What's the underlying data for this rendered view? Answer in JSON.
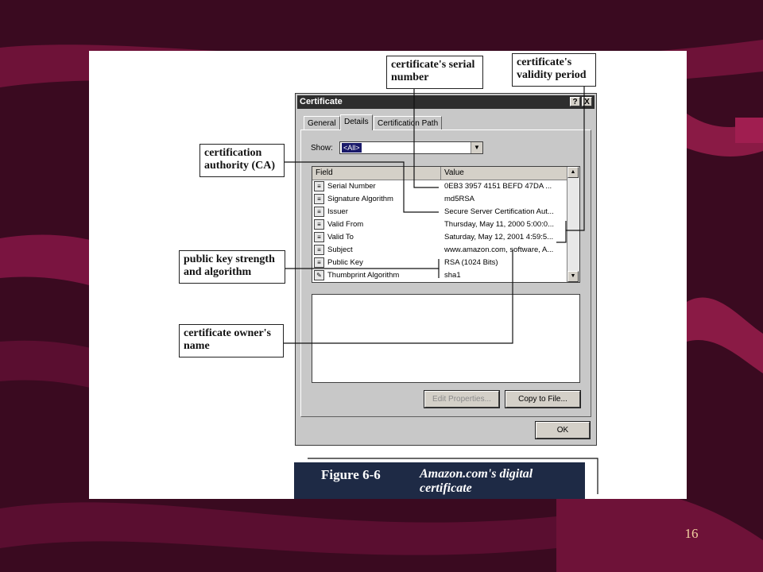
{
  "slide": {
    "page_number": "16"
  },
  "dialog": {
    "title": "Certificate",
    "help_btn": "?",
    "close_btn": "X",
    "tabs": [
      "General",
      "Details",
      "Certification Path"
    ],
    "show_label": "Show:",
    "show_value": "<All>",
    "columns": {
      "field": "Field",
      "value": "Value"
    },
    "rows": [
      {
        "field": "Serial Number",
        "value": "0EB3 3957 4151 BEFD 47DA ..."
      },
      {
        "field": "Signature Algorithm",
        "value": "md5RSA"
      },
      {
        "field": "Issuer",
        "value": "Secure Server Certification Aut..."
      },
      {
        "field": "Valid From",
        "value": "Thursday, May 11, 2000 5:00:0..."
      },
      {
        "field": "Valid To",
        "value": "Saturday, May 12, 2001 4:59:5..."
      },
      {
        "field": "Subject",
        "value": "www.amazon.com, software, A..."
      },
      {
        "field": "Public Key",
        "value": "RSA (1024 Bits)"
      },
      {
        "field": "Thumbprint Algorithm",
        "value": "sha1"
      }
    ],
    "edit_properties": "Edit Properties...",
    "copy_to_file": "Copy to File...",
    "ok": "OK"
  },
  "callouts": {
    "serial": "certificate's serial number",
    "validity": "certificate's validity period",
    "ca": "certification authority (CA)",
    "public_key": "public key strength and algorithm",
    "owner": "certificate owner's name"
  },
  "figure": {
    "label": "Figure 6-6",
    "title": "Amazon.com's digital certificate"
  },
  "colors": {
    "background": "#3a0a20",
    "swoosh": "#8a1a45",
    "caption_bg": "#1e2a45",
    "page_number": "#f2d0a0"
  }
}
